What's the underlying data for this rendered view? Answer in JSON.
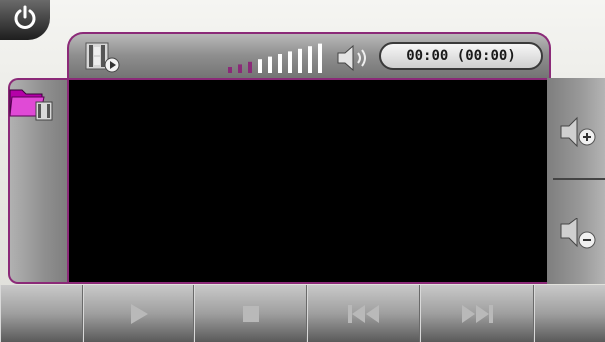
{
  "time_display": "00:00 (00:00)",
  "volume": {
    "active_bars": 3,
    "total_bars": 10
  },
  "accent_color": "#8b2a78",
  "icons": {
    "power": "power-icon",
    "video_file": "video-file-icon",
    "speaker": "speaker-icon",
    "open_folder": "folder-video-icon",
    "volume_up": "volume-up-icon",
    "volume_down": "volume-down-icon",
    "play": "play-icon",
    "stop": "stop-icon",
    "previous": "previous-icon",
    "next": "next-icon"
  }
}
